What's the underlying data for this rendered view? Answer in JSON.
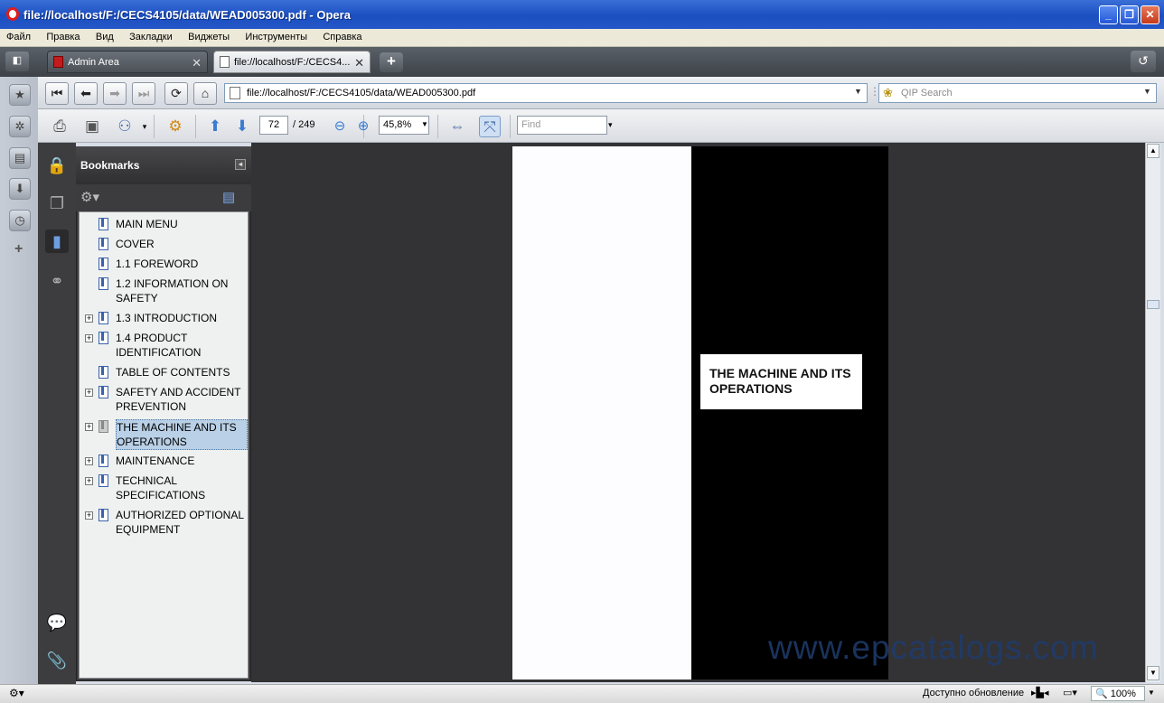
{
  "window": {
    "title": "file://localhost/F:/CECS4105/data/WEAD005300.pdf - Opera"
  },
  "menu": [
    "Файл",
    "Правка",
    "Вид",
    "Закладки",
    "Виджеты",
    "Инструменты",
    "Справка"
  ],
  "tabs": [
    {
      "label": "Admin Area",
      "active": false
    },
    {
      "label": "file://localhost/F:/CECS4...",
      "active": true
    }
  ],
  "address": {
    "url": "file://localhost/F:/CECS4105/data/WEAD005300.pdf"
  },
  "search": {
    "placeholder": "QIP Search"
  },
  "pdf_toolbar": {
    "page_current": "72",
    "page_total": "/ 249",
    "zoom": "45,8%",
    "find_placeholder": "Find"
  },
  "bookmarks": {
    "title": "Bookmarks",
    "items": [
      {
        "label": "MAIN MENU",
        "expandable": false,
        "selected": false
      },
      {
        "label": "COVER",
        "expandable": false,
        "selected": false
      },
      {
        "label": "1.1 FOREWORD",
        "expandable": false,
        "selected": false
      },
      {
        "label": "1.2 INFORMATION ON SAFETY",
        "expandable": false,
        "selected": false
      },
      {
        "label": "1.3 INTRODUCTION",
        "expandable": true,
        "selected": false
      },
      {
        "label": "1.4 PRODUCT IDENTIFICATION",
        "expandable": true,
        "selected": false
      },
      {
        "label": "TABLE OF CONTENTS",
        "expandable": false,
        "selected": false
      },
      {
        "label": "SAFETY AND ACCIDENT PREVENTION",
        "expandable": true,
        "selected": false
      },
      {
        "label": "THE MACHINE AND ITS OPERATIONS",
        "expandable": true,
        "selected": true
      },
      {
        "label": "MAINTENANCE",
        "expandable": true,
        "selected": false
      },
      {
        "label": "TECHNICAL SPECIFICATIONS",
        "expandable": true,
        "selected": false
      },
      {
        "label": "AUTHORIZED OPTIONAL EQUIPMENT",
        "expandable": true,
        "selected": false
      }
    ]
  },
  "page": {
    "heading": "THE MACHINE AND ITS OPERATIONS"
  },
  "watermark": "www.epcatalogs.com",
  "status": {
    "update": "Доступно обновление",
    "zoom": "100%"
  }
}
